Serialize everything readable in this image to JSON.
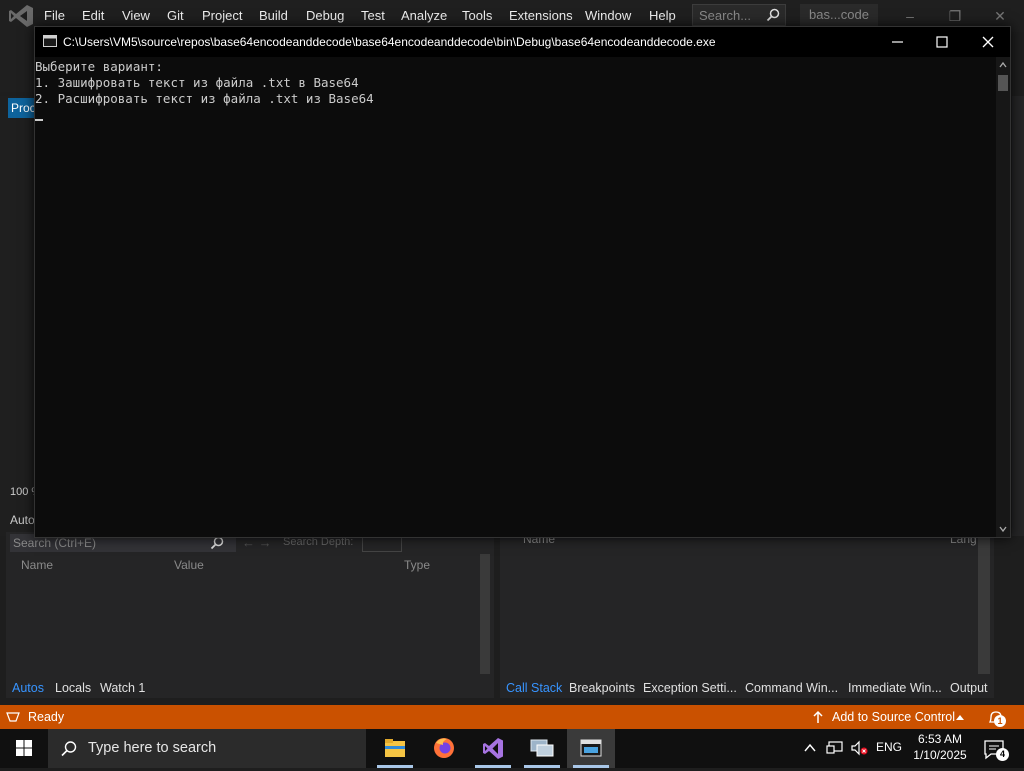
{
  "vs": {
    "menu": [
      "File",
      "Edit",
      "View",
      "Git",
      "Project",
      "Build",
      "Debug",
      "Test",
      "Analyze",
      "Tools",
      "Extensions",
      "Window",
      "Help"
    ],
    "search_placeholder": "Search...",
    "solution_name": "bas...code",
    "left_tab_label": "Proc",
    "zoom": "100 %",
    "autos_frag": "Auto"
  },
  "console": {
    "title": "C:\\Users\\VM5\\source\\repos\\base64encodeanddecode\\base64encodeanddecode\\bin\\Debug\\base64encodeanddecode.exe",
    "lines": [
      "Выберите вариант:",
      "1. Зашифровать текст из файла .txt в Base64",
      "2. Расшифровать текст из файла .txt из Base64"
    ]
  },
  "autos": {
    "search_placeholder": "Search (Ctrl+E)",
    "depth_label": "Search Depth:",
    "columns": [
      "Name",
      "Value",
      "Type"
    ]
  },
  "callstack": {
    "columns": [
      "Name",
      "Lang"
    ]
  },
  "bottom_tabs_left": [
    "Autos",
    "Locals",
    "Watch 1"
  ],
  "bottom_tabs_right": [
    "Call Stack",
    "Breakpoints",
    "Exception Setti...",
    "Command Win...",
    "Immediate Win...",
    "Output"
  ],
  "statusbar": {
    "ready": "Ready",
    "source_control": "Add to Source Control",
    "notifications": "1",
    "color": "#ca5100"
  },
  "taskbar": {
    "search_placeholder": "Type here to search",
    "apps": [
      "file-explorer-icon",
      "firefox-icon",
      "visual-studio-icon",
      "network-app-icon",
      "console-app-icon"
    ],
    "lang": "ENG",
    "time": "6:53 AM",
    "date": "1/10/2025",
    "notification_count": "4"
  }
}
